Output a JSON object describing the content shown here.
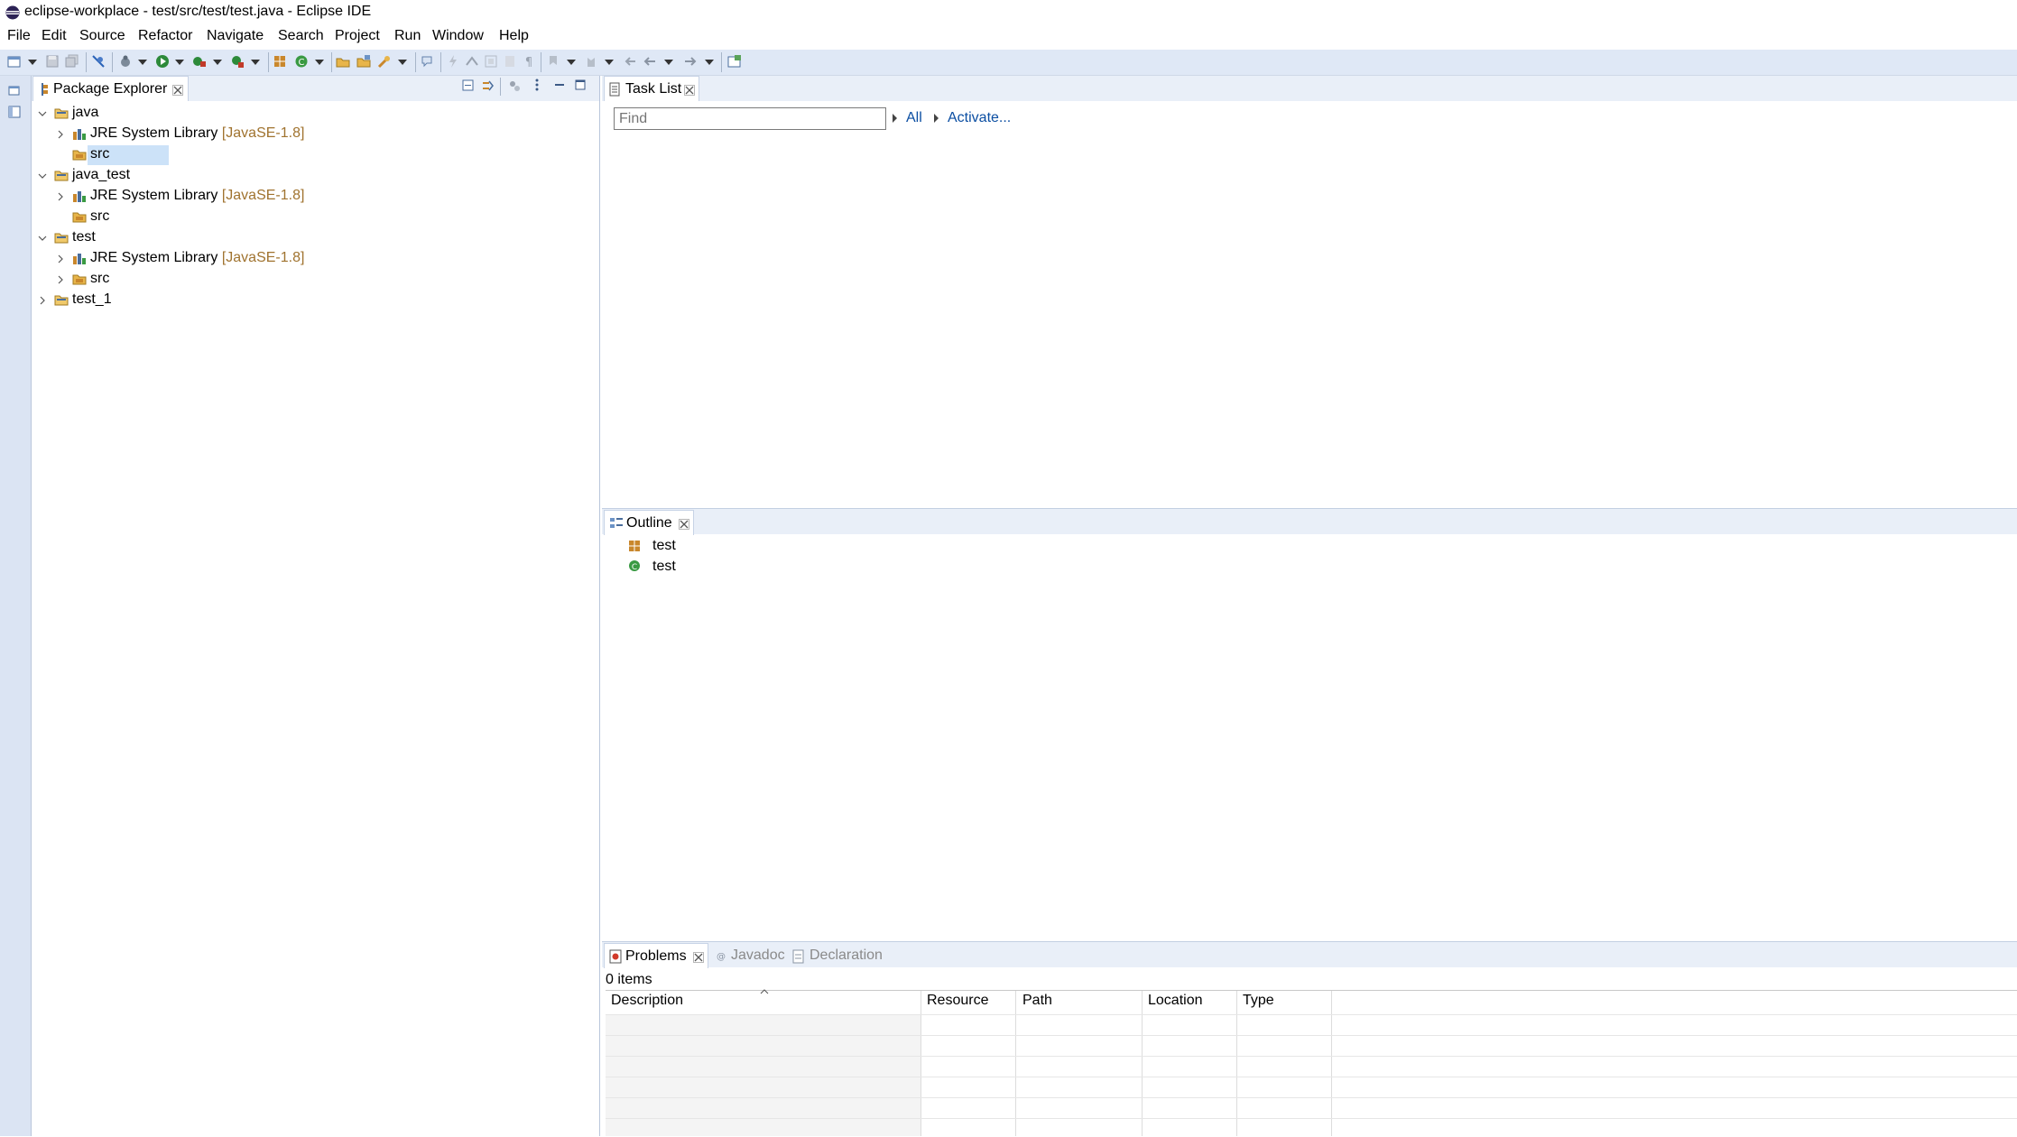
{
  "window": {
    "title": "eclipse-workplace - test/src/test/test.java - Eclipse IDE"
  },
  "menu": [
    "File",
    "Edit",
    "Source",
    "Refactor",
    "Navigate",
    "Search",
    "Project",
    "Run",
    "Window",
    "Help"
  ],
  "package_explorer": {
    "tab_label": "Package Explorer",
    "tree": [
      {
        "label": "java",
        "decoration": "",
        "expanded": true
      },
      {
        "label": "JRE System Library",
        "decoration": "[JavaSE-1.8]"
      },
      {
        "label": "src",
        "decoration": "",
        "selected": true
      },
      {
        "label": "java_test",
        "decoration": "",
        "expanded": true
      },
      {
        "label": "JRE System Library",
        "decoration": "[JavaSE-1.8]"
      },
      {
        "label": "src",
        "decoration": ""
      },
      {
        "label": "test",
        "decoration": "",
        "expanded": true
      },
      {
        "label": "JRE System Library",
        "decoration": "[JavaSE-1.8]"
      },
      {
        "label": "src",
        "decoration": ""
      },
      {
        "label": "test_1",
        "decoration": ""
      }
    ]
  },
  "task_list": {
    "tab_label": "Task List",
    "find_placeholder": "Find",
    "all_link": "All",
    "activate_link": "Activate..."
  },
  "outline": {
    "tab_label": "Outline",
    "items": [
      {
        "label": "test",
        "icon": "package-icon"
      },
      {
        "label": "test",
        "icon": "class-icon"
      }
    ]
  },
  "problems": {
    "tabs": [
      "Problems",
      "Javadoc",
      "Declaration"
    ],
    "count_text": "0 items",
    "columns": [
      "Description",
      "Resource",
      "Path",
      "Location",
      "Type"
    ]
  },
  "colors": {
    "accent": "#0b4ea2",
    "decoration": "#a0732f",
    "chrome": "#dfe8f6"
  }
}
